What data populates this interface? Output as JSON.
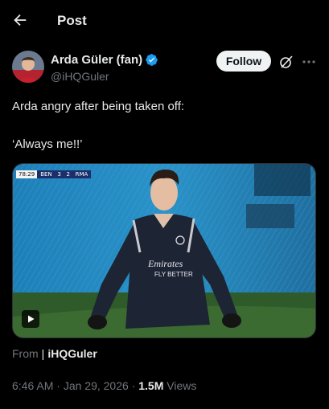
{
  "header": {
    "title": "Post",
    "back_icon": "back-arrow-icon"
  },
  "author": {
    "display_name": "Arda Güler (fan)",
    "handle": "@iHQGuler",
    "verified_color": "#1d9bf0",
    "avatar_icon": "user-avatar"
  },
  "actions": {
    "follow_label": "Follow",
    "grok_icon": "grok-icon",
    "more_icon": "more-options-icon"
  },
  "tweet": {
    "line1": "Arda angry after being taken off:",
    "line2": "‘Always me!!’"
  },
  "media": {
    "type": "video",
    "play_icon": "play-icon",
    "scorebug": {
      "time": "78:29",
      "teams": "BEN   3   2   RMA"
    },
    "jersey_text": "Emirates FLY BETTER"
  },
  "source": {
    "prefix": "From",
    "separator": "|",
    "name": "iHQGuler"
  },
  "meta": {
    "time": "6:46 AM",
    "date": "Jan 29, 2026",
    "views_count": "1.5M",
    "views_label": "Views"
  },
  "colors": {
    "background": "#000000",
    "text": "#e7e9ea",
    "muted": "#71767b",
    "accent": "#1d9bf0"
  }
}
